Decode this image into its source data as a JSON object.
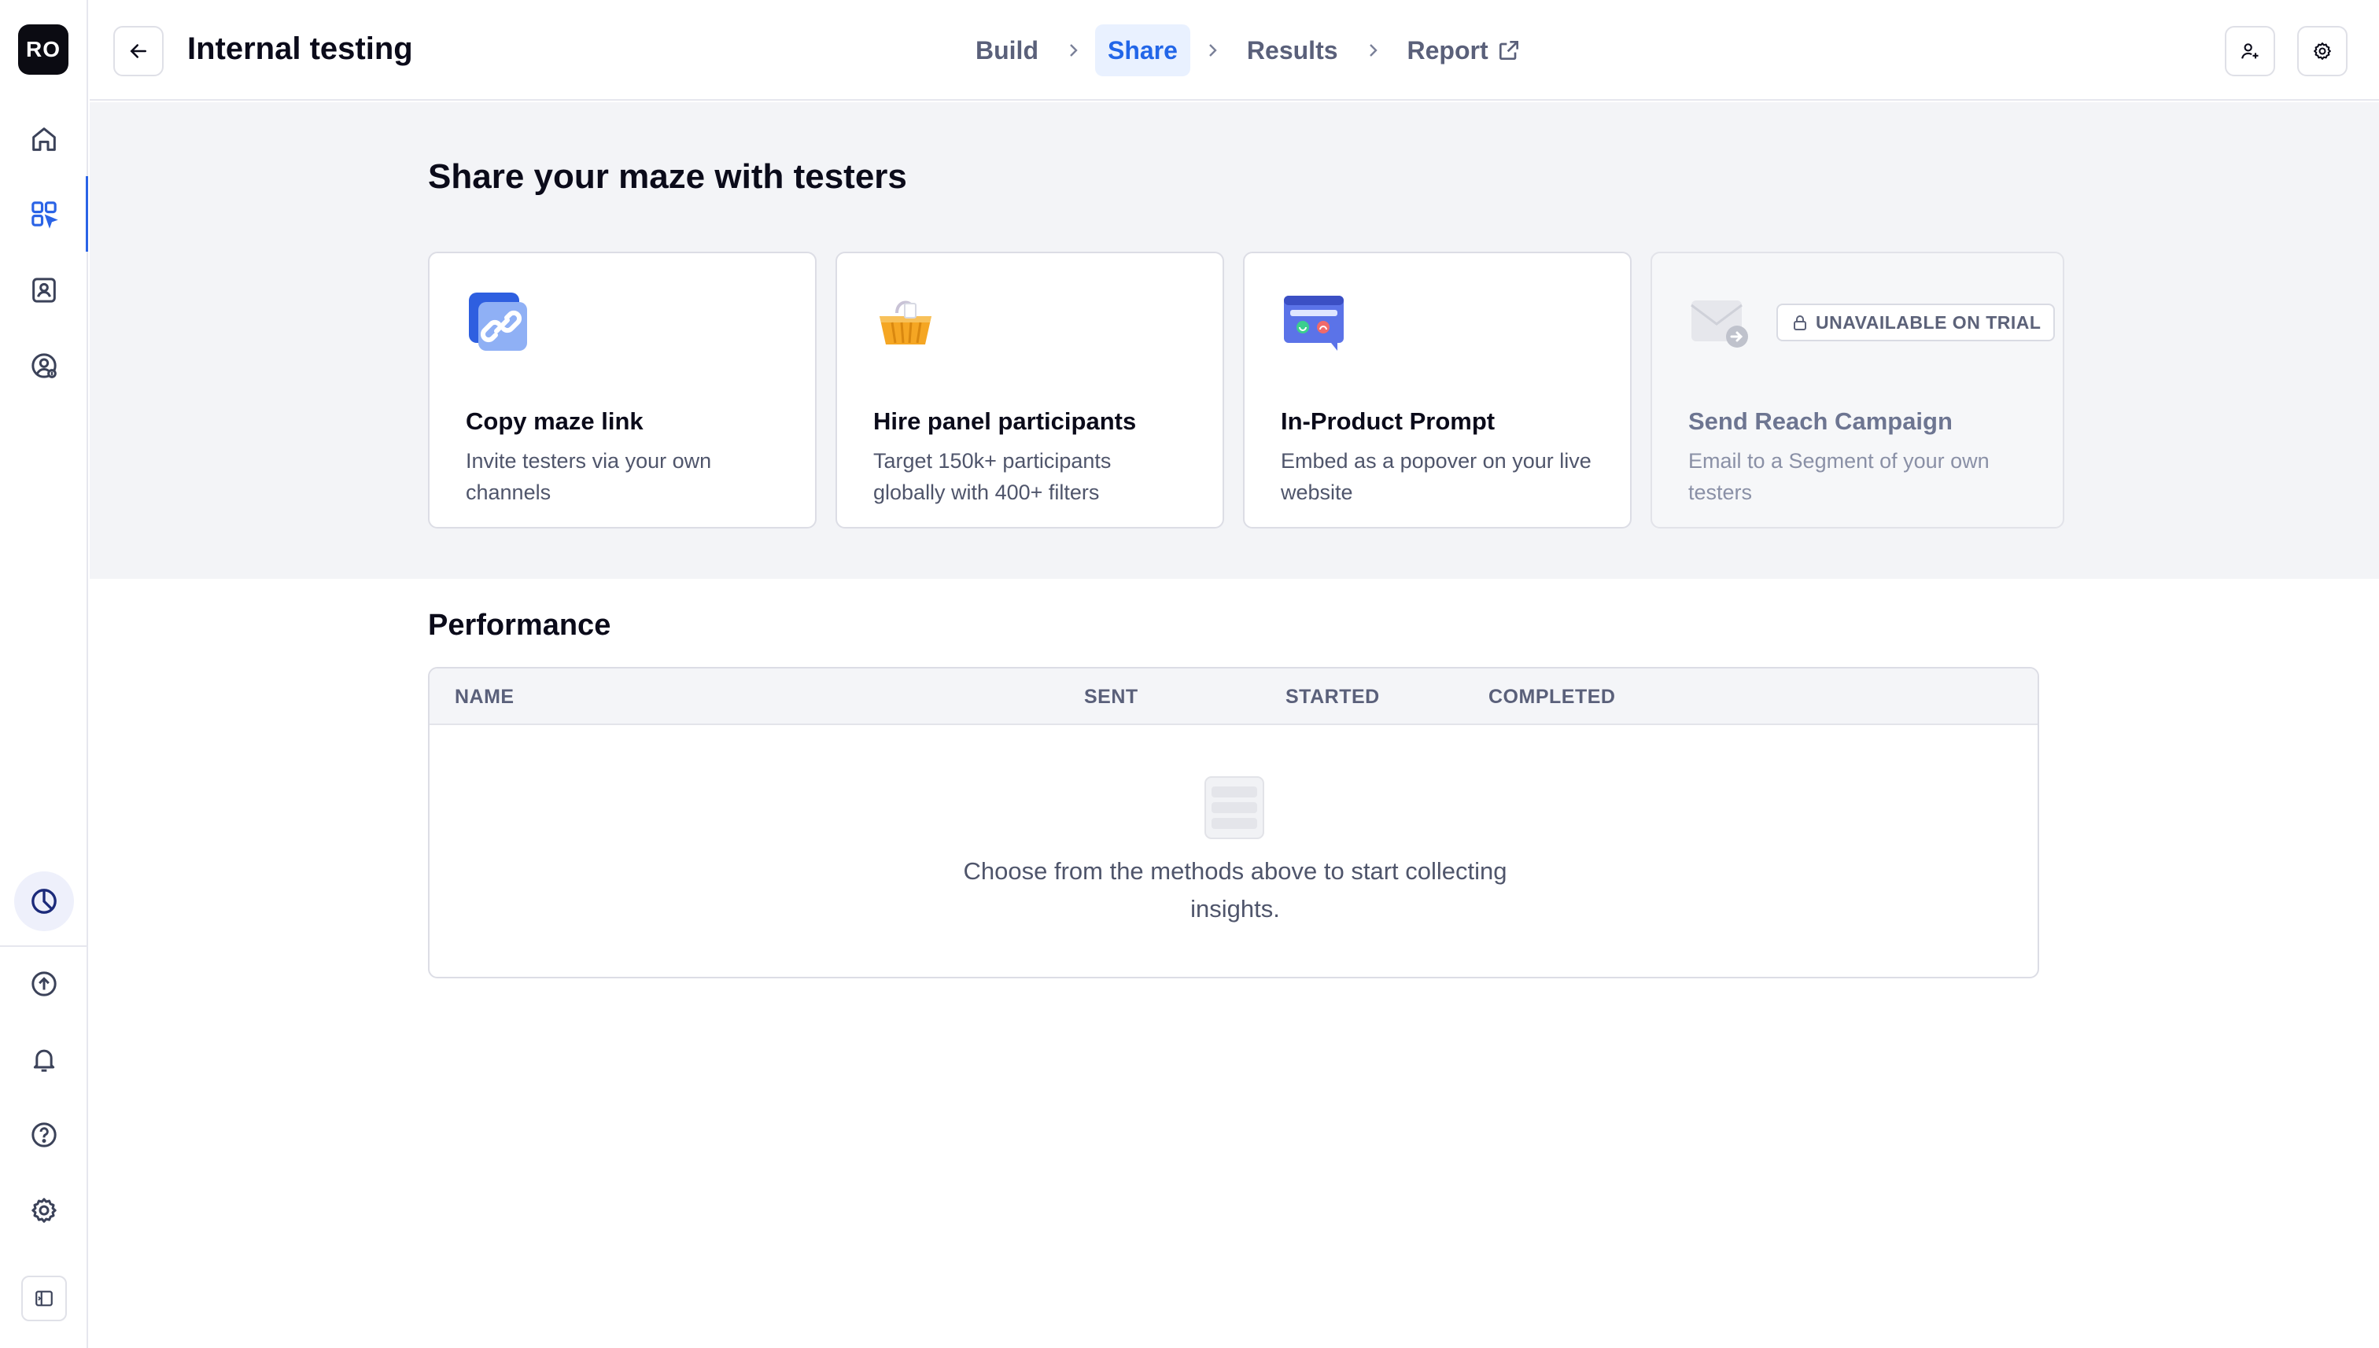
{
  "workspace": {
    "initials": "RO"
  },
  "sidebar": {
    "top_items": [
      {
        "name": "home",
        "icon": "home-icon"
      },
      {
        "name": "projects",
        "icon": "grid-icon"
      },
      {
        "name": "contacts",
        "icon": "contacts-icon"
      },
      {
        "name": "account",
        "icon": "user-circle-icon"
      }
    ],
    "bottom_items": [
      {
        "name": "usage",
        "icon": "pie-chart-icon"
      },
      {
        "name": "upload",
        "icon": "upload-icon"
      },
      {
        "name": "notifications",
        "icon": "bell-icon"
      },
      {
        "name": "help",
        "icon": "help-icon"
      },
      {
        "name": "settings",
        "icon": "gear-icon"
      },
      {
        "name": "collapse",
        "icon": "sidebar-toggle-icon"
      }
    ],
    "active_color": "#2a63e6"
  },
  "header": {
    "title": "Internal testing",
    "steps": [
      {
        "label": "Build",
        "active": false
      },
      {
        "label": "Share",
        "active": true
      },
      {
        "label": "Results",
        "active": false
      },
      {
        "label": "Report",
        "active": false,
        "external": true
      }
    ]
  },
  "share": {
    "title": "Share your maze with testers",
    "cards": [
      {
        "icon": "link-icon",
        "title": "Copy maze link",
        "description": "Invite testers via your own channels",
        "disabled": false
      },
      {
        "icon": "basket-icon",
        "title": "Hire panel participants",
        "description": "Target 150k+ participants globally with 400+ filters",
        "disabled": false
      },
      {
        "icon": "prompt-icon",
        "title": "In-Product Prompt",
        "description": "Embed as a popover on your live website",
        "disabled": false
      },
      {
        "icon": "email-icon",
        "title": "Send Reach Campaign",
        "description": "Email to a Segment of your own testers",
        "disabled": true,
        "badge": "UNAVAILABLE ON TRIAL"
      }
    ]
  },
  "performance": {
    "title": "Performance",
    "columns": [
      "NAME",
      "SENT",
      "STARTED",
      "COMPLETED"
    ],
    "empty_message": "Choose from the methods above to start collecting insights."
  },
  "colors": {
    "accent": "#2266e8",
    "accent_bg": "#e9f1ff",
    "section_bg": "#f3f4f7"
  }
}
